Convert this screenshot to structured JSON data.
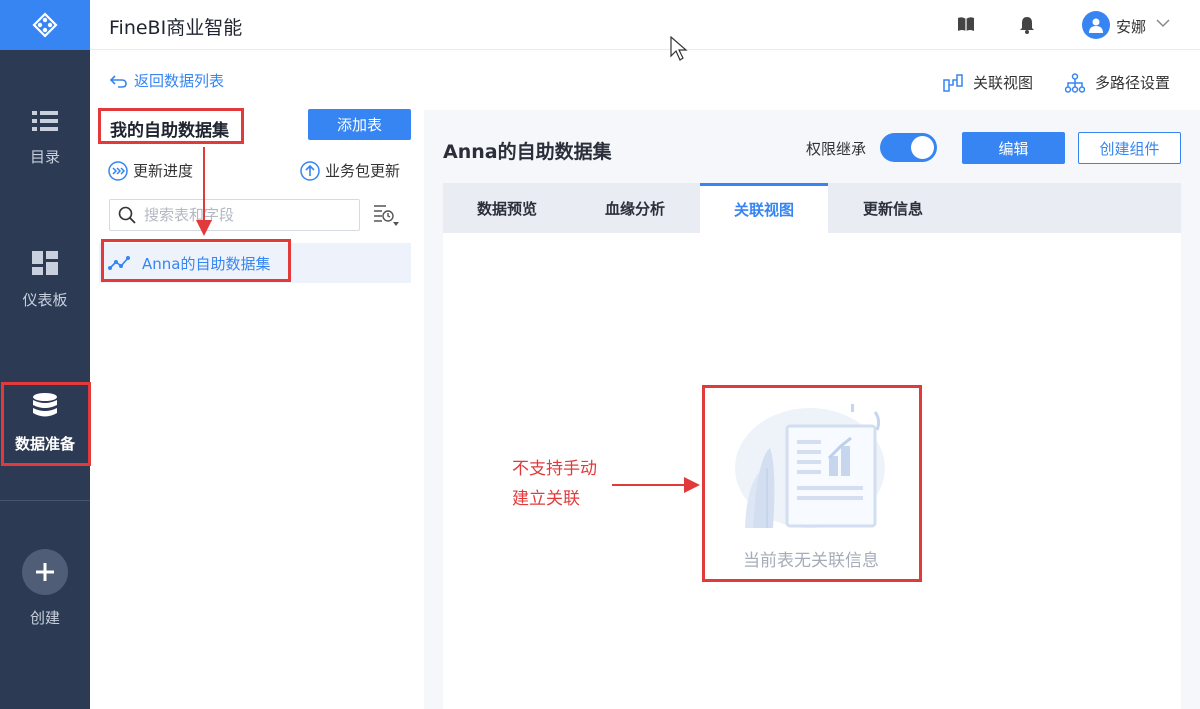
{
  "app": {
    "title": "FineBI商业智能"
  },
  "nav": {
    "items": [
      {
        "label": "目录",
        "icon": "list-icon"
      },
      {
        "label": "仪表板",
        "icon": "dashboard-icon"
      },
      {
        "label": "数据准备",
        "icon": "database-icon",
        "active": true
      },
      {
        "label": "创建",
        "icon": "plus-icon"
      }
    ]
  },
  "user": {
    "name": "安娜"
  },
  "panel": {
    "back_label": "返回数据列表",
    "group_title": "我的自助数据集",
    "add_button": "添加表",
    "update_progress": "更新进度",
    "package_update": "业务包更新",
    "search_placeholder": "搜索表和字段",
    "dataset_item": "Anna的自助数据集"
  },
  "header_actions": {
    "relation_view": "关联视图",
    "multipath": "多路径设置"
  },
  "dataset": {
    "title": "Anna的自助数据集",
    "inherit_label": "权限继承",
    "inherit_on": true,
    "edit_button": "编辑",
    "create_component_button": "创建组件"
  },
  "tabs": [
    {
      "label": "数据预览"
    },
    {
      "label": "血缘分析"
    },
    {
      "label": "关联视图",
      "active": true
    },
    {
      "label": "更新信息"
    }
  ],
  "empty_state": {
    "text": "当前表无关联信息"
  },
  "annotation": {
    "line1": "不支持手动",
    "line2": "建立关联"
  },
  "colors": {
    "accent": "#3685f2",
    "nav_bg": "#2c3a54",
    "annotation": "#e23a3a"
  }
}
